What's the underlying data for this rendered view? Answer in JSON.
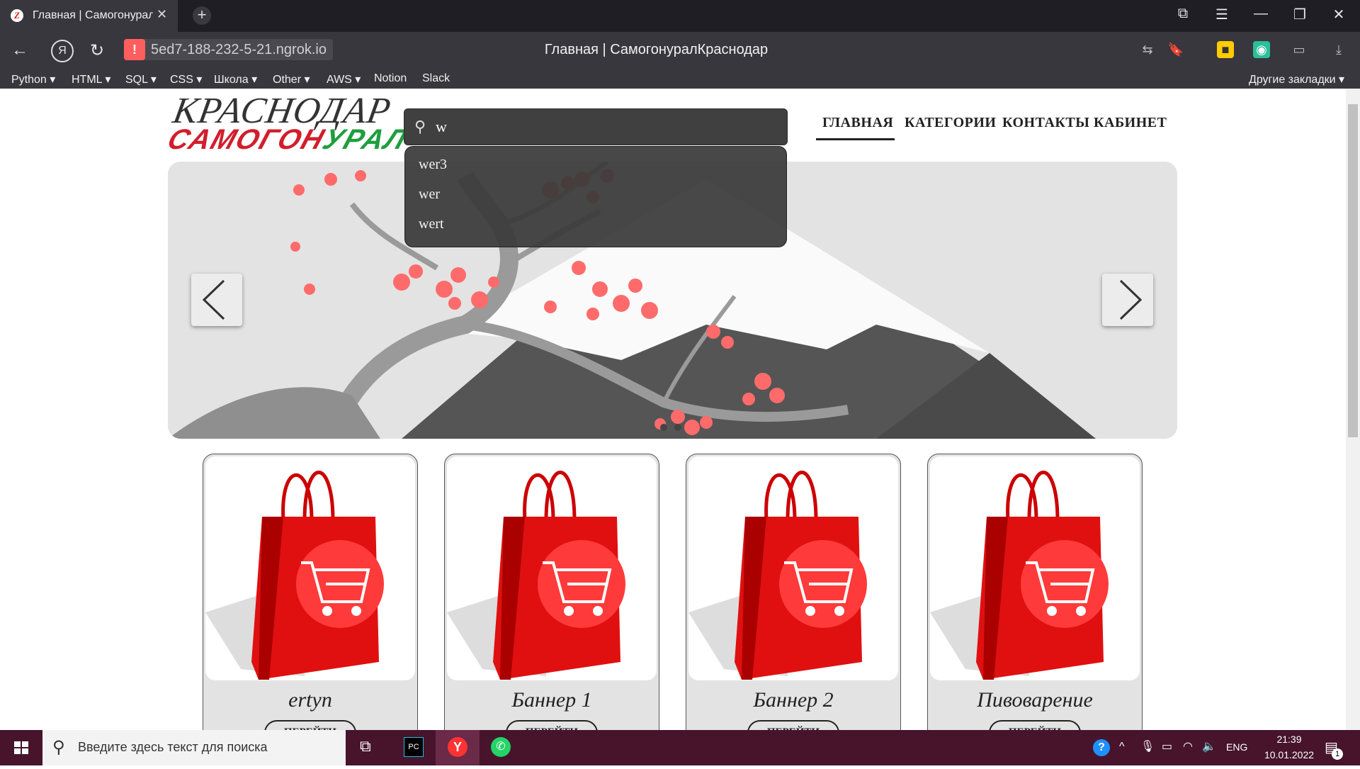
{
  "browser": {
    "tab_title": "Главная | Самогонурал",
    "tab_favicon_letter": "Z",
    "url": "5ed7-188-232-5-21.ngrok.io",
    "page_title": "Главная | СамогонуралКраснодар",
    "bookmarks": [
      "Python ▾",
      "HTML ▾",
      "SQL ▾",
      "CSS ▾",
      "Школа ▾",
      "Other ▾",
      "AWS ▾",
      "Notion",
      "Slack"
    ],
    "other_bookmarks": "Другие закладки ▾"
  },
  "site": {
    "logo_line1": "КРАСНОДАР",
    "logo_red": "САМОГОН",
    "logo_green": "УРАЛ",
    "search_value": "w",
    "suggestions": [
      "wer3",
      "wer",
      "wert"
    ],
    "nav": [
      "ГЛАВНАЯ",
      "КАТЕГОРИИ",
      "КОНТАКТЫ",
      "КАБИНЕТ"
    ],
    "active_nav": "ГЛАВНАЯ",
    "cards": [
      {
        "name": "ertyn",
        "button": "ПЕРЕЙТИ"
      },
      {
        "name": "Баннер 1",
        "button": "ПЕРЕЙТИ"
      },
      {
        "name": "Баннер 2",
        "button": "ПЕРЕЙТИ"
      },
      {
        "name": "Пивоварение",
        "button": "ПЕРЕЙТИ"
      }
    ],
    "colors": {
      "logo_red": "#d21e2b",
      "logo_green": "#1e9e3e",
      "blossom": "#ff6b6b"
    }
  },
  "taskbar": {
    "search_placeholder": "Введите здесь текст для поиска",
    "lang": "ENG",
    "time": "21:39",
    "date": "10.01.2022",
    "notification_count": "1"
  }
}
